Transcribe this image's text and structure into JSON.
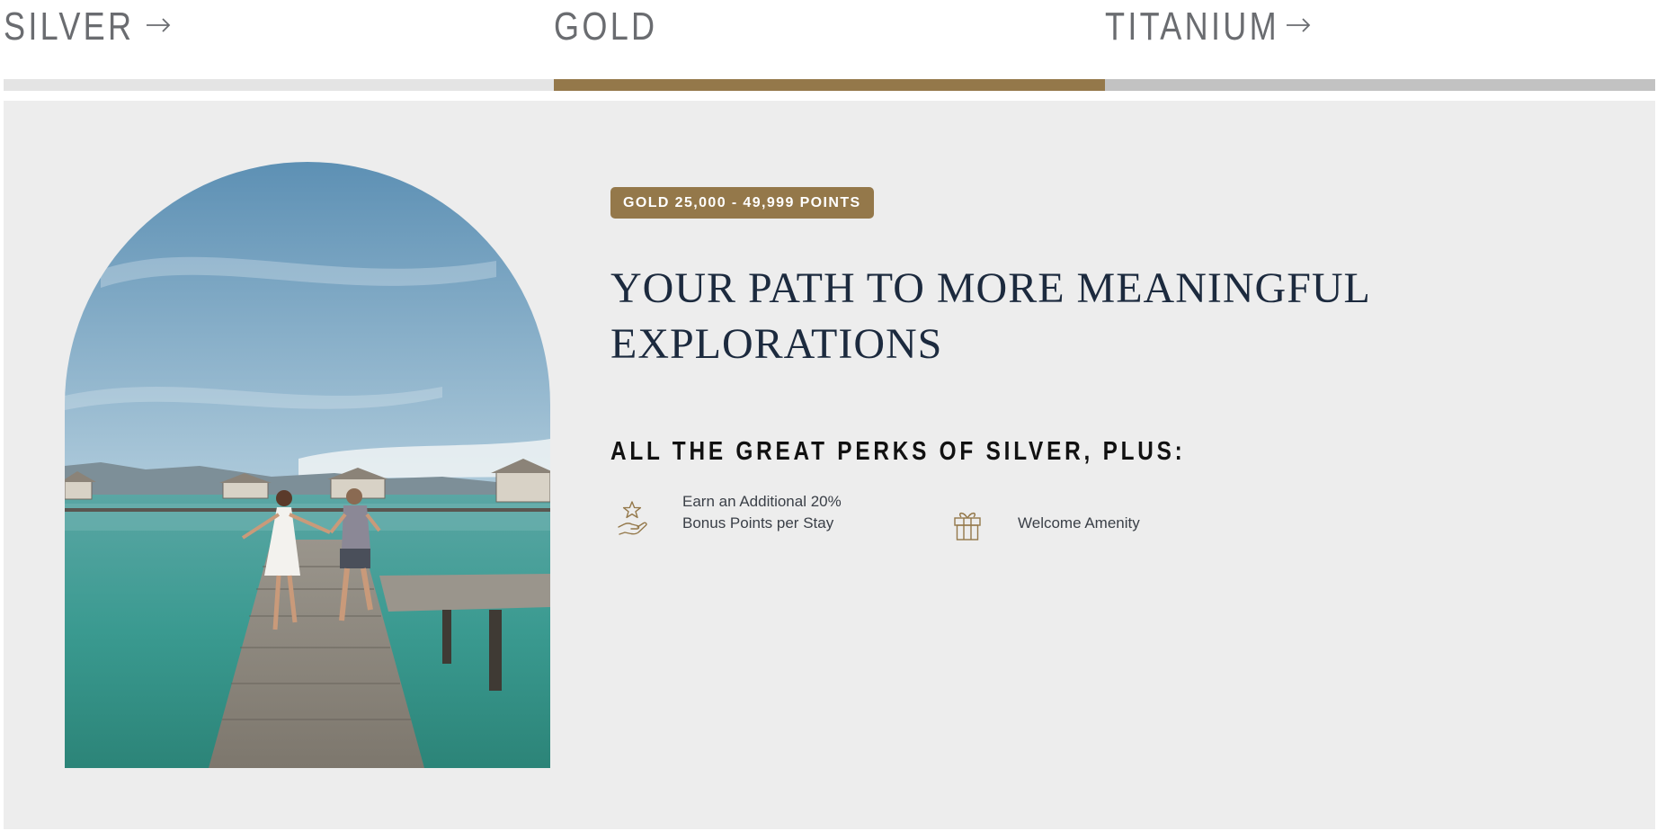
{
  "tiers": {
    "silver": {
      "label": "SILVER",
      "icon": "arrow-right-icon"
    },
    "gold": {
      "label": "GOLD",
      "active": true
    },
    "titanium": {
      "label": "TITANIUM",
      "icon": "arrow-right-icon"
    }
  },
  "colors": {
    "accent_gold": "#94784a",
    "panel_bg": "#ededed",
    "heading_navy": "#1c2a3e",
    "tab_text": "#6a6c70"
  },
  "content": {
    "badge": "GOLD 25,000 - 49,999 POINTS",
    "headline": "YOUR PATH TO MORE MEANINGFUL EXPLORATIONS",
    "subhead": "ALL THE GREAT PERKS OF SILVER, PLUS:",
    "perks": [
      {
        "icon": "hand-star-icon",
        "text": "Earn an Additional 20% Bonus Points per Stay"
      },
      {
        "icon": "gift-icon",
        "text": "Welcome Amenity"
      }
    ]
  }
}
